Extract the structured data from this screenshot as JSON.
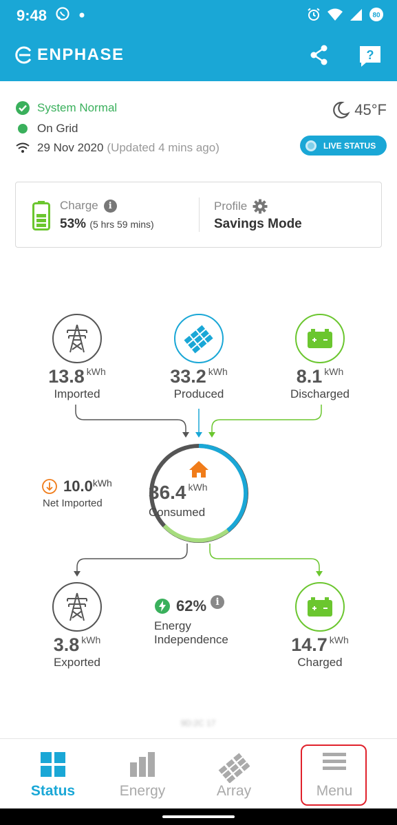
{
  "statusbar": {
    "time": "9:48",
    "battery_level": "80"
  },
  "app": {
    "brand": "ENPHASE"
  },
  "status": {
    "system": "System Normal",
    "grid": "On Grid",
    "date": "29 Nov 2020",
    "updated": "(Updated 4 mins ago)",
    "temperature": "45°F",
    "live_status": "LIVE STATUS"
  },
  "battery": {
    "charge_label": "Charge",
    "charge_value": "53%",
    "charge_time": "(5 hrs 59 mins)",
    "profile_label": "Profile",
    "profile_value": "Savings Mode"
  },
  "flow": {
    "imported": {
      "value": "13.8",
      "unit": "kWh",
      "label": "Imported"
    },
    "produced": {
      "value": "33.2",
      "unit": "kWh",
      "label": "Produced"
    },
    "discharged": {
      "value": "8.1",
      "unit": "kWh",
      "label": "Discharged"
    },
    "consumed": {
      "value": "36.4",
      "unit": "kWh",
      "label": "Consumed"
    },
    "net": {
      "value": "10.0",
      "unit": "kWh",
      "label": "Net Imported"
    },
    "exported": {
      "value": "3.8",
      "unit": "kWh",
      "label": "Exported"
    },
    "charged": {
      "value": "14.7",
      "unit": "kWh",
      "label": "Charged"
    },
    "independence": {
      "value": "62%",
      "label_line1": "Energy",
      "label_line2": "Independence"
    }
  },
  "footer_text": "9D:2C 17",
  "nav": {
    "status": "Status",
    "energy": "Energy",
    "array": "Array",
    "menu": "Menu"
  },
  "colors": {
    "brand": "#1aa7d6",
    "ok": "#3ab05c",
    "battery": "#6bc62f",
    "home": "#f07c1a",
    "highlight": "#e0212b"
  }
}
